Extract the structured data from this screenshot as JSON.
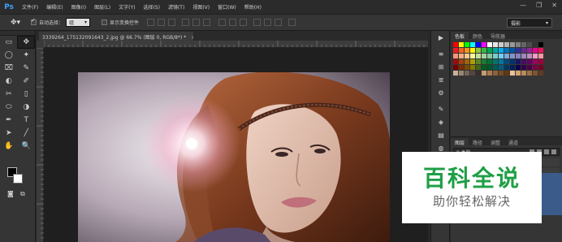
{
  "app": {
    "logo": "Ps"
  },
  "menu": [
    "文件(F)",
    "编辑(E)",
    "图像(I)",
    "图层(L)",
    "文字(Y)",
    "选择(S)",
    "滤镜(T)",
    "视图(V)",
    "窗口(W)",
    "帮助(H)"
  ],
  "window_controls": {
    "minimize": "—",
    "restore": "❐",
    "close": "✕"
  },
  "options_bar": {
    "tool_icon": "move-icon",
    "auto_select_label": "自动选择：",
    "auto_select_checked": true,
    "auto_select_value": "组",
    "show_transform_label": "显示变换控件",
    "show_transform_checked": false,
    "workspace": "摄影"
  },
  "document": {
    "tab_title": "3339264_1751320916​43_2.jpg @ 66.7% (图层 0, RGB/8*) *",
    "close": "×"
  },
  "toolbar": {
    "rows": [
      [
        "▭",
        "✥"
      ],
      [
        "◯",
        "✦"
      ],
      [
        "⌧",
        "✎"
      ],
      [
        "◐",
        "✐"
      ],
      [
        "✂",
        "▯"
      ],
      [
        "⬭",
        "◑"
      ],
      [
        "✒",
        "T"
      ],
      [
        "➤",
        "╱"
      ],
      [
        "✋",
        "🔍"
      ]
    ]
  },
  "right_strip": [
    "▶",
    "≡",
    "⊞",
    "≣",
    "⚙",
    "✎",
    "◈",
    "▤",
    "◍",
    "¶",
    "▦",
    "⊕",
    "⊟"
  ],
  "swatches_panel": {
    "tabs": [
      "色板",
      "颜色",
      "导航器"
    ],
    "colors": [
      "#ff0000",
      "#ffff00",
      "#00ff00",
      "#00ffff",
      "#0000ff",
      "#ff00ff",
      "#ffffff",
      "#e6e6e6",
      "#cccccc",
      "#b3b3b3",
      "#999999",
      "#808080",
      "#666666",
      "#4d4d4d",
      "#333333",
      "#000000",
      "#ed1c24",
      "#f26522",
      "#f7941d",
      "#fff200",
      "#8dc63f",
      "#39b54a",
      "#00a651",
      "#00a99d",
      "#00aeef",
      "#0072bc",
      "#0054a6",
      "#2e3192",
      "#662d91",
      "#92278f",
      "#ec008c",
      "#ed145b",
      "#f69679",
      "#f9ad81",
      "#fdc68a",
      "#fff799",
      "#c4df9b",
      "#a3d39c",
      "#82ca9d",
      "#7accc8",
      "#6dcff6",
      "#7da7d9",
      "#8393ca",
      "#8781bd",
      "#a187be",
      "#bc8dbf",
      "#f49ac2",
      "#f6989d",
      "#9e0b0f",
      "#a0410d",
      "#a3620a",
      "#aba000",
      "#598527",
      "#1a7b30",
      "#007236",
      "#00746b",
      "#0076a3",
      "#004a80",
      "#003471",
      "#1b1464",
      "#440e62",
      "#630460",
      "#9e005d",
      "#9e0039",
      "#790000",
      "#7b2e00",
      "#7d4900",
      "#827b00",
      "#406618",
      "#005e20",
      "#005826",
      "#005952",
      "#005b7f",
      "#003663",
      "#002157",
      "#0d004c",
      "#32004b",
      "#4b0049",
      "#7b0046",
      "#7a0026",
      "#c7b299",
      "#998675",
      "#736357",
      "#534741",
      "#37302a",
      "#c69c6d",
      "#a67c52",
      "#8c6239",
      "#754c24",
      "#603913",
      "#e8c39e",
      "#d5a26e",
      "#b88a5c",
      "#9b6f43",
      "#7e5531",
      "#603a1e"
    ]
  },
  "layers_panel": {
    "tabs": [
      "图层",
      "路径",
      "调整",
      "通道"
    ],
    "filter_label": "P 类型"
  },
  "watermark": {
    "title": "百科全说",
    "subtitle": "助你轻松解决"
  }
}
